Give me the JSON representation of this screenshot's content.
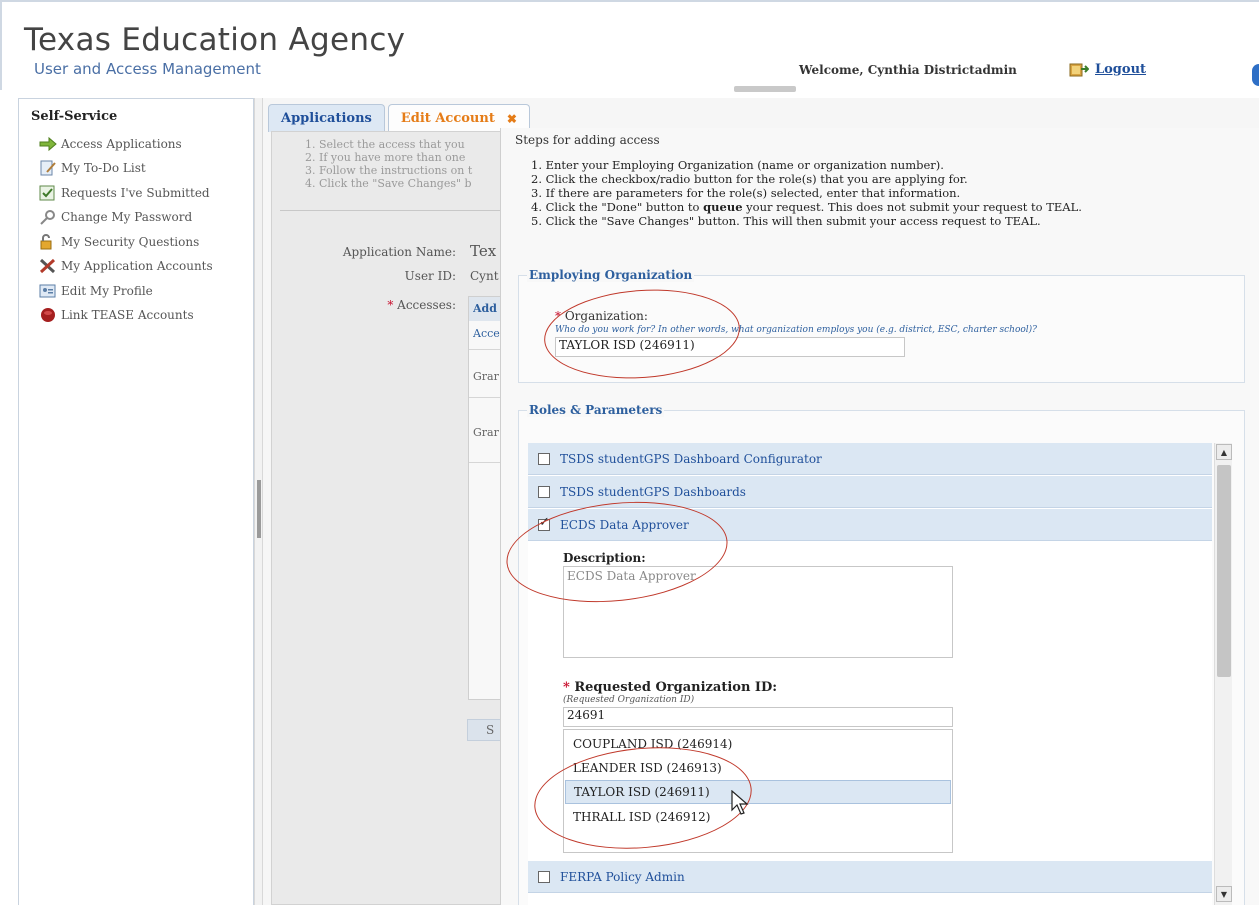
{
  "header": {
    "agency_title": "Texas Education Agency",
    "subtitle": "User and Access Management",
    "welcome": "Welcome, Cynthia Districtadmin",
    "logout_label": "Logout"
  },
  "sidebar": {
    "title": "Self-Service",
    "items": [
      {
        "label": "Access Applications",
        "icon": "arrow-right-icon"
      },
      {
        "label": "My To-Do List",
        "icon": "notepad-icon"
      },
      {
        "label": "Requests I've Submitted",
        "icon": "document-check-icon"
      },
      {
        "label": "Change My Password",
        "icon": "key-icon"
      },
      {
        "label": "My Security Questions",
        "icon": "padlock-icon"
      },
      {
        "label": "My Application Accounts",
        "icon": "tools-icon"
      },
      {
        "label": "Edit My Profile",
        "icon": "profile-card-icon"
      },
      {
        "label": "Link TEASE Accounts",
        "icon": "link-badge-icon"
      }
    ]
  },
  "tabs": {
    "applications": "Applications",
    "edit_account": "Edit Account",
    "close_glyph": "✖"
  },
  "background_panel": {
    "steps": [
      "1. Select the access that you",
      "2. If you have more than one",
      "3. Follow the instructions on t",
      "4. Click the \"Save Changes\" b"
    ],
    "app_name_label": "Application Name:",
    "app_name_value": "Tex",
    "user_id_label": "User ID:",
    "user_id_value": "Cynt",
    "accesses_label": "Accesses:",
    "access_header": "Add",
    "access_sub": "Acce",
    "access_row1": "Grar",
    "access_row2": "Grar",
    "save_fragment": "S"
  },
  "dialog": {
    "steps_title": "Steps for adding access",
    "steps": {
      "s1": "1.  Enter your Employing Organization (name or organization number).",
      "s2": "2.  Click the checkbox/radio button for the role(s) that you are applying for.",
      "s3": "3.  If there are parameters for the role(s) selected, enter that information.",
      "s4_pre": "4.  Click the \"Done\" button to ",
      "s4_bold": "queue",
      "s4_post": " your request. This does not submit your request to TEAL.",
      "s5": "5.  Click the \"Save Changes\" button. This will then submit your access request to TEAL."
    },
    "employing_org": {
      "legend": "Employing Organization",
      "label": "Organization:",
      "required_mark": "*",
      "hint": "Who do you work for? In other words, what organization employs you (e.g. district, ESC, charter school)?",
      "value": "TAYLOR ISD (246911)"
    },
    "roles": {
      "legend": "Roles & Parameters",
      "items": [
        {
          "label": "TSDS studentGPS Dashboard Configurator",
          "checked": false
        },
        {
          "label": "TSDS studentGPS Dashboards",
          "checked": false
        },
        {
          "label": "ECDS Data Approver",
          "checked": true
        },
        {
          "label": "FERPA Policy Admin",
          "checked": false
        }
      ],
      "description_label": "Description:",
      "description_value": "ECDS Data Approver",
      "requested_org_label": "Requested Organization ID:",
      "requested_org_hint": "(Requested Organization ID)",
      "requested_org_value": "24691",
      "suggestions": [
        "COUPLAND ISD (246914)",
        "LEANDER ISD (246913)",
        "TAYLOR ISD (246911)",
        "THRALL ISD (246912)"
      ],
      "selected_suggestion": "TAYLOR ISD (246911)"
    }
  },
  "colors": {
    "link_blue": "#1f4f9a",
    "tab_orange": "#e57c17",
    "annotation_red": "#c0392b",
    "role_row_bg": "#dbe7f3"
  }
}
